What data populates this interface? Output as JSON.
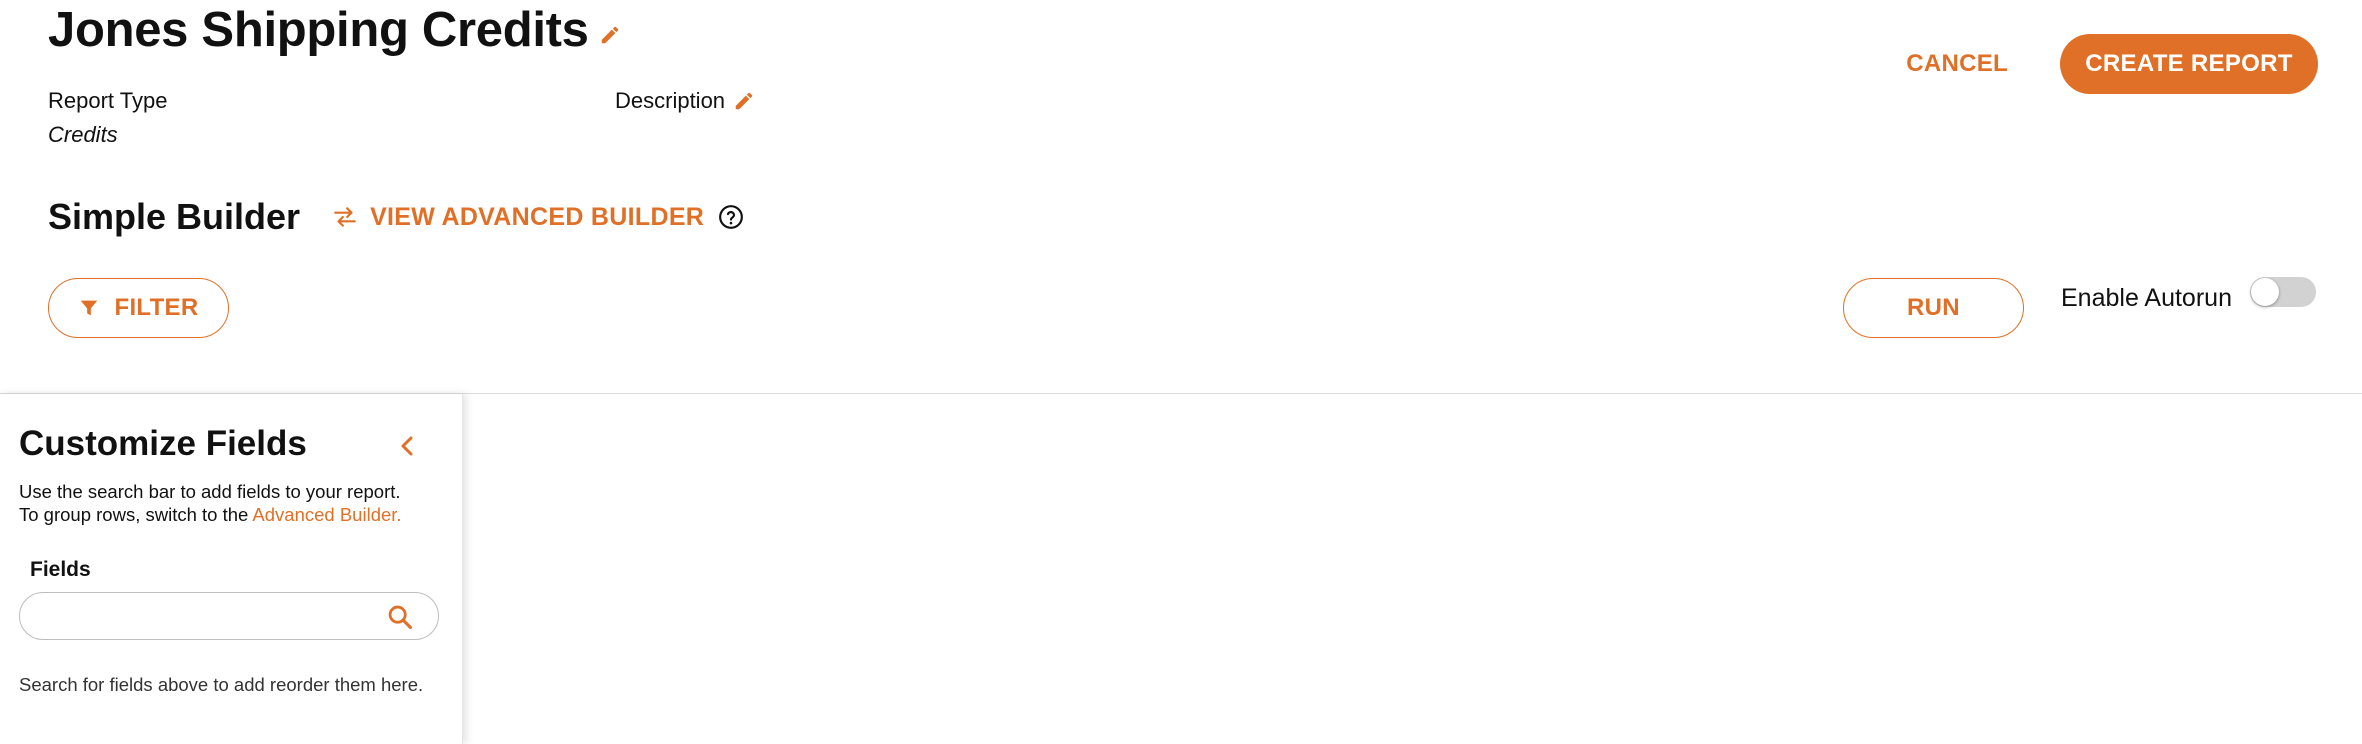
{
  "colors": {
    "accent": "#e07027",
    "toggle_off": "#d2d2d2"
  },
  "header": {
    "title": "Jones Shipping Credits",
    "report_type_label": "Report Type",
    "report_type_value": "Credits",
    "description_label": "Description",
    "cancel_label": "CANCEL",
    "create_label": "CREATE REPORT"
  },
  "builder": {
    "title": "Simple Builder",
    "advanced_link": "VIEW ADVANCED BUILDER",
    "filter_label": "FILTER",
    "run_label": "RUN",
    "autorun_label": "Enable Autorun",
    "autorun_enabled": false
  },
  "panel": {
    "title": "Customize Fields",
    "help_line1": "Use the search bar to add fields to your report.",
    "help_line2_prefix": "To group rows, switch to the ",
    "help_link": "Advanced Builder.",
    "fields_label": "Fields",
    "search_value": "",
    "empty_message": "Search for fields above to add reorder them here."
  },
  "icons": {
    "title_edit": "pencil-icon",
    "description_edit": "pencil-icon",
    "advanced_swap": "swap-arrows-icon",
    "help": "question-circle-icon",
    "filter": "funnel-icon",
    "collapse": "chevron-left-icon",
    "search": "search-icon"
  }
}
